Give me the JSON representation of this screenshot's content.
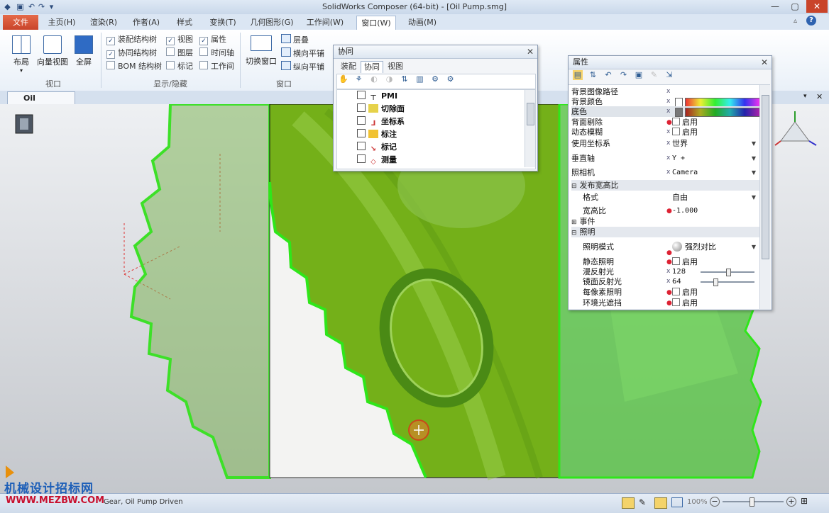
{
  "window": {
    "title": "SolidWorks Composer (64-bit) - [Oil Pump.smg]",
    "min": "—",
    "max": "▢",
    "close": "✕"
  },
  "ribbon": {
    "file_tab": "文件",
    "tabs": [
      "主页(H)",
      "渲染(R)",
      "作者(A)",
      "样式",
      "变换(T)",
      "几何图形(G)",
      "工作间(W)",
      "窗口(W)",
      "动画(M)"
    ],
    "active_tab": "窗口(W)",
    "help": "?",
    "groups": {
      "viewport": {
        "label": "视口",
        "buttons": [
          "布局",
          "向量视图",
          "全屏"
        ]
      },
      "show_hide": {
        "label": "显示/隐藏",
        "checks": [
          {
            "label": "装配结构树",
            "checked": true
          },
          {
            "label": "协同结构树",
            "checked": true
          },
          {
            "label": "BOM 结构树",
            "checked": false
          },
          {
            "label": "视图",
            "checked": true
          },
          {
            "label": "图层",
            "checked": false
          },
          {
            "label": "标记",
            "checked": false
          },
          {
            "label": "属性",
            "checked": true
          },
          {
            "label": "时间轴",
            "checked": false
          },
          {
            "label": "工作间",
            "checked": false
          }
        ]
      },
      "window": {
        "label": "窗口",
        "switch_button": "切换窗口",
        "small_buttons": [
          "层叠",
          "横向平铺",
          "纵向平铺"
        ]
      }
    }
  },
  "document": {
    "tab_label": "Oil Pump.smg"
  },
  "collab_panel": {
    "title": "协同",
    "tabs": [
      "装配",
      "协同",
      "视图"
    ],
    "active_tab": "协同",
    "items": [
      {
        "label": "PMI",
        "icon": "pmi-icon"
      },
      {
        "label": "切除面",
        "icon": "cut-plane-icon"
      },
      {
        "label": "坐标系",
        "icon": "coordinate-system-icon"
      },
      {
        "label": "标注",
        "icon": "annotation-icon"
      },
      {
        "label": "标记",
        "icon": "markup-icon"
      },
      {
        "label": "测量",
        "icon": "measure-icon"
      }
    ]
  },
  "props_panel": {
    "title": "属性",
    "rows": [
      {
        "name": "背景图像路径",
        "value": ""
      },
      {
        "name": "背景颜色",
        "value": "",
        "swatch": "rainbow"
      },
      {
        "name": "底色",
        "value": "",
        "swatch": "rainbow-dark"
      },
      {
        "name": "背面剔除",
        "value": "启用"
      },
      {
        "name": "动态模糊",
        "value": "启用"
      },
      {
        "name": "使用坐标系",
        "value": "世界"
      },
      {
        "name": "垂直轴",
        "value": "Y +"
      },
      {
        "name": "照相机",
        "value": "Camera"
      }
    ],
    "section_publish": "发布宽高比",
    "format_name": "格式",
    "format_value": "自由",
    "ratio_name": "宽高比",
    "ratio_value": "-1.000",
    "section_events": "事件",
    "section_lighting": "照明",
    "light_mode_name": "照明模式",
    "light_mode_value": "强烈对比",
    "static_light_name": "静态照明",
    "static_light_value": "启用",
    "diffuse_name": "漫反射光",
    "diffuse_value": "128",
    "specular_name": "镜面反射光",
    "specular_value": "64",
    "pixel_light_name": "每像素照明",
    "pixel_light_value": "启用",
    "ambient_occ_name": "环境光遮挡",
    "ambient_occ_value": "启用"
  },
  "status": {
    "text": "Gear, Oil Pump Driven",
    "zoom": "100%",
    "watermark_line1": "机械设计招标网",
    "watermark_line2": "WWW.MEZBW.COM"
  },
  "colors": {
    "gear_green": "#6bbf2a",
    "gear_outline": "#2fe61a",
    "ribbon_bg": "#eef3f9",
    "accent": "#c9442a"
  }
}
